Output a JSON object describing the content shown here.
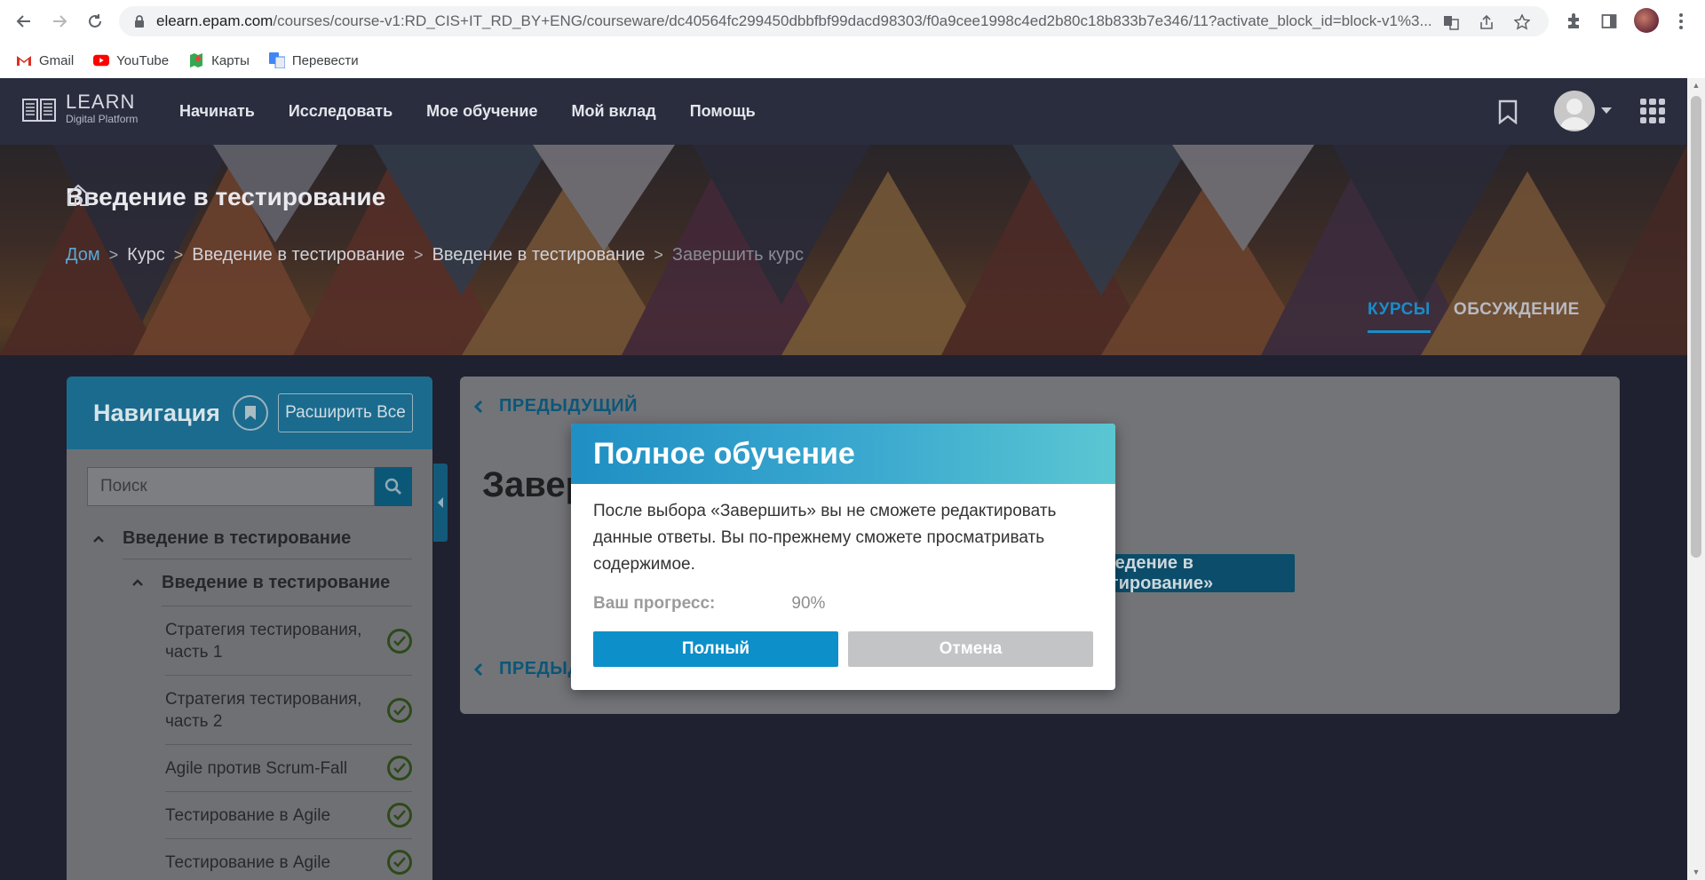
{
  "browser": {
    "url_main": "elearn.epam.com",
    "url_rest": "/courses/course-v1:RD_CIS+IT_RD_BY+ENG/courseware/dc40564fc299450dbbfbf99dacd98303/f0a9cee1998c4ed2b80c18b833b7e346/11?activate_block_id=block-v1%3...",
    "bookmarks": [
      "Gmail",
      "YouTube",
      "Карты",
      "Перевести"
    ]
  },
  "topnav": {
    "logo_line1": "LEARN",
    "logo_line2": "Digital Platform",
    "menu": [
      "Начинать",
      "Исследовать",
      "Мое обучение",
      "Мой вклад",
      "Помощь"
    ]
  },
  "hero": {
    "course_title": "Введение в тестирование",
    "breadcrumb": {
      "home": "Дом",
      "items": [
        "Курс",
        "Введение в тестирование",
        "Введение в тестирование"
      ],
      "current": "Завершить курс"
    },
    "tabs": [
      "КУРСЫ",
      "ОБСУЖДЕНИЕ"
    ]
  },
  "sidebar": {
    "title": "Навигация",
    "expand_label": "Расширить Все",
    "search_placeholder": "Поиск",
    "section": "Введение в тестирование",
    "subsection": "Введение в тестирование",
    "units": [
      "Стратегия тестирования, часть 1",
      "Стратегия тестирования, часть 2",
      "Agile против Scrum-Fall",
      "Тестирование в Agile",
      "Тестирование в Agile"
    ]
  },
  "content": {
    "prev_top": "ПРЕДЫДУЩИЙ",
    "heading": "Завершить курс",
    "button_partial": "«Введение в тестирование»",
    "prev_bottom": "ПРЕДЫДУЩИЙ"
  },
  "modal": {
    "title": "Полное обучение",
    "body": "После выбора «Завершить» вы не сможете редактировать данные ответы. Вы по-прежнему сможете просматривать содержимое.",
    "progress_label": "Ваш прогресс:",
    "progress_value": "90%",
    "confirm_label": "Полный",
    "cancel_label": "Отмена"
  }
}
